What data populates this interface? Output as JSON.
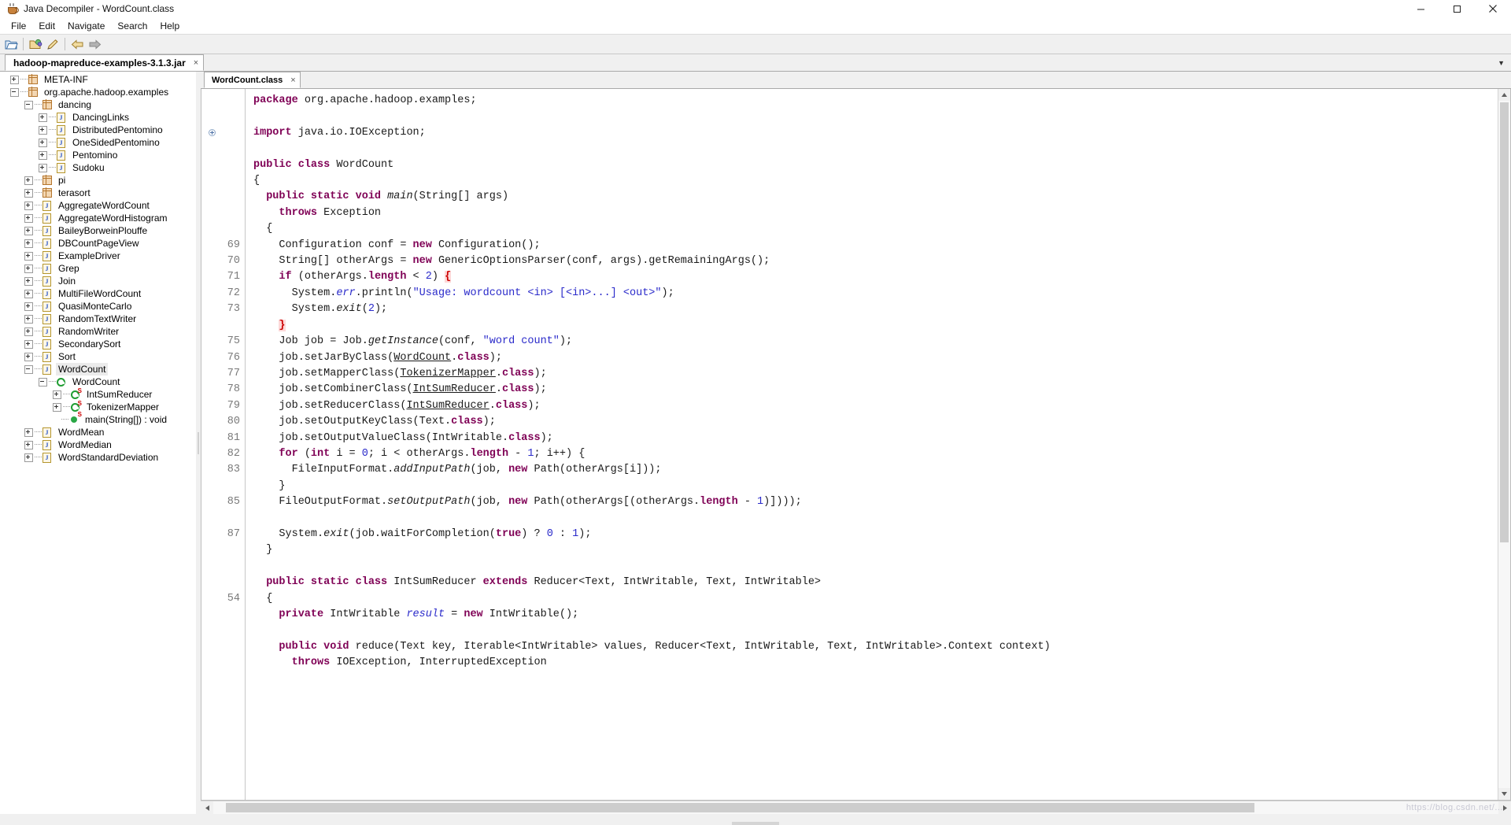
{
  "window": {
    "title": "Java Decompiler - WordCount.class",
    "icon": "java-cup-icon",
    "minimize_label": "─",
    "maximize_label": "❐",
    "close_label": "✕"
  },
  "menubar": {
    "items": [
      {
        "label": "File",
        "mnemonic": "F"
      },
      {
        "label": "Edit",
        "mnemonic": "E"
      },
      {
        "label": "Navigate",
        "mnemonic": "N"
      },
      {
        "label": "Search",
        "mnemonic": "a"
      },
      {
        "label": "Help",
        "mnemonic": "H"
      }
    ]
  },
  "toolbar": {
    "buttons": [
      {
        "name": "open-file-icon",
        "title": "Open File"
      },
      {
        "name": "open-type-icon",
        "title": "Open Type"
      },
      {
        "name": "save-source-icon",
        "title": "Save Source"
      },
      {
        "name": "back-arrow-icon",
        "title": "Back"
      },
      {
        "name": "forward-arrow-icon",
        "title": "Forward"
      }
    ]
  },
  "jar_tabs": {
    "tabs": [
      {
        "label": "hadoop-mapreduce-examples-3.1.3.jar",
        "close": "×",
        "active": true
      }
    ],
    "overflow": "▼"
  },
  "tree": {
    "nodes": [
      {
        "depth": 0,
        "toggle": "plus",
        "icon": "package-icon",
        "label": "META-INF",
        "selected": false
      },
      {
        "depth": 0,
        "toggle": "minus",
        "icon": "package-icon",
        "label": "org.apache.hadoop.examples",
        "selected": false
      },
      {
        "depth": 1,
        "toggle": "minus",
        "icon": "package-icon",
        "label": "dancing",
        "selected": false
      },
      {
        "depth": 2,
        "toggle": "plus",
        "icon": "class-file-icon",
        "label": "DancingLinks",
        "selected": false
      },
      {
        "depth": 2,
        "toggle": "plus",
        "icon": "class-file-icon",
        "label": "DistributedPentomino",
        "selected": false
      },
      {
        "depth": 2,
        "toggle": "plus",
        "icon": "class-file-icon",
        "label": "OneSidedPentomino",
        "selected": false
      },
      {
        "depth": 2,
        "toggle": "plus",
        "icon": "class-file-icon",
        "label": "Pentomino",
        "selected": false
      },
      {
        "depth": 2,
        "toggle": "plus",
        "icon": "class-file-icon",
        "label": "Sudoku",
        "selected": false
      },
      {
        "depth": 1,
        "toggle": "plus",
        "icon": "package-icon",
        "label": "pi",
        "selected": false
      },
      {
        "depth": 1,
        "toggle": "plus",
        "icon": "package-icon",
        "label": "terasort",
        "selected": false
      },
      {
        "depth": 1,
        "toggle": "plus",
        "icon": "class-file-icon",
        "label": "AggregateWordCount",
        "selected": false
      },
      {
        "depth": 1,
        "toggle": "plus",
        "icon": "class-file-icon",
        "label": "AggregateWordHistogram",
        "selected": false
      },
      {
        "depth": 1,
        "toggle": "plus",
        "icon": "class-file-icon",
        "label": "BaileyBorweinPlouffe",
        "selected": false
      },
      {
        "depth": 1,
        "toggle": "plus",
        "icon": "class-file-icon",
        "label": "DBCountPageView",
        "selected": false
      },
      {
        "depth": 1,
        "toggle": "plus",
        "icon": "class-file-icon",
        "label": "ExampleDriver",
        "selected": false
      },
      {
        "depth": 1,
        "toggle": "plus",
        "icon": "class-file-icon",
        "label": "Grep",
        "selected": false
      },
      {
        "depth": 1,
        "toggle": "plus",
        "icon": "class-file-icon",
        "label": "Join",
        "selected": false
      },
      {
        "depth": 1,
        "toggle": "plus",
        "icon": "class-file-icon",
        "label": "MultiFileWordCount",
        "selected": false
      },
      {
        "depth": 1,
        "toggle": "plus",
        "icon": "class-file-icon",
        "label": "QuasiMonteCarlo",
        "selected": false
      },
      {
        "depth": 1,
        "toggle": "plus",
        "icon": "class-file-icon",
        "label": "RandomTextWriter",
        "selected": false
      },
      {
        "depth": 1,
        "toggle": "plus",
        "icon": "class-file-icon",
        "label": "RandomWriter",
        "selected": false
      },
      {
        "depth": 1,
        "toggle": "plus",
        "icon": "class-file-icon",
        "label": "SecondarySort",
        "selected": false
      },
      {
        "depth": 1,
        "toggle": "plus",
        "icon": "class-file-icon",
        "label": "Sort",
        "selected": false
      },
      {
        "depth": 1,
        "toggle": "minus",
        "icon": "class-file-icon",
        "label": "WordCount",
        "selected": true
      },
      {
        "depth": 2,
        "toggle": "minus",
        "icon": "class-icon",
        "label": "WordCount",
        "selected": false
      },
      {
        "depth": 3,
        "toggle": "plus",
        "icon": "class-static-icon",
        "label": "IntSumReducer",
        "selected": false
      },
      {
        "depth": 3,
        "toggle": "plus",
        "icon": "class-static-icon",
        "label": "TokenizerMapper",
        "selected": false
      },
      {
        "depth": 3,
        "toggle": "none",
        "icon": "method-static-icon",
        "label": "main(String[]) : void",
        "selected": false
      },
      {
        "depth": 1,
        "toggle": "plus",
        "icon": "class-file-icon",
        "label": "WordMean",
        "selected": false
      },
      {
        "depth": 1,
        "toggle": "plus",
        "icon": "class-file-icon",
        "label": "WordMedian",
        "selected": false
      },
      {
        "depth": 1,
        "toggle": "plus",
        "icon": "class-file-icon",
        "label": "WordStandardDeviation",
        "selected": false
      }
    ]
  },
  "file_tabs": {
    "tabs": [
      {
        "label": "WordCount.class",
        "close": "×",
        "active": true
      }
    ]
  },
  "editor": {
    "line_numbers": [
      "",
      "",
      "",
      "",
      "",
      "",
      "",
      "",
      "",
      "69",
      "70",
      "71",
      "72",
      "73",
      "",
      "75",
      "76",
      "77",
      "78",
      "79",
      "80",
      "81",
      "82",
      "83",
      "",
      "85",
      "",
      "87",
      "",
      "",
      "",
      "54",
      "",
      ""
    ],
    "fold_marker_line": 2,
    "lines": [
      [
        {
          "t": "package ",
          "c": "kw"
        },
        {
          "t": "org.apache.hadoop.examples;",
          "c": ""
        }
      ],
      [
        {
          "t": "",
          "c": ""
        }
      ],
      [
        {
          "t": "import ",
          "c": "kw"
        },
        {
          "t": "java.io.IOException;",
          "c": ""
        }
      ],
      [
        {
          "t": "",
          "c": ""
        }
      ],
      [
        {
          "t": "public class ",
          "c": "kw"
        },
        {
          "t": "WordCount",
          "c": ""
        }
      ],
      [
        {
          "t": "{",
          "c": ""
        }
      ],
      [
        {
          "t": "  ",
          "c": ""
        },
        {
          "t": "public static void ",
          "c": "kw"
        },
        {
          "t": "main",
          "c": "mth"
        },
        {
          "t": "(String[] args)",
          "c": ""
        }
      ],
      [
        {
          "t": "    ",
          "c": ""
        },
        {
          "t": "throws ",
          "c": "kw"
        },
        {
          "t": "Exception",
          "c": ""
        }
      ],
      [
        {
          "t": "  {",
          "c": ""
        }
      ],
      [
        {
          "t": "    Configuration conf = ",
          "c": ""
        },
        {
          "t": "new ",
          "c": "kw"
        },
        {
          "t": "Configuration();",
          "c": ""
        }
      ],
      [
        {
          "t": "    String[] otherArgs = ",
          "c": ""
        },
        {
          "t": "new ",
          "c": "kw"
        },
        {
          "t": "GenericOptionsParser(conf, args).getRemainingArgs();",
          "c": ""
        }
      ],
      [
        {
          "t": "    ",
          "c": ""
        },
        {
          "t": "if ",
          "c": "kw"
        },
        {
          "t": "(otherArgs.",
          "c": ""
        },
        {
          "t": "length",
          "c": "kw"
        },
        {
          "t": " < ",
          "c": ""
        },
        {
          "t": "2",
          "c": "num"
        },
        {
          "t": ") ",
          "c": ""
        },
        {
          "t": "{",
          "c": "brc"
        }
      ],
      [
        {
          "t": "      System.",
          "c": ""
        },
        {
          "t": "err",
          "c": "fld"
        },
        {
          "t": ".println(",
          "c": ""
        },
        {
          "t": "\"Usage: wordcount <in> [<in>...] <out>\"",
          "c": "str"
        },
        {
          "t": ");",
          "c": ""
        }
      ],
      [
        {
          "t": "      System.",
          "c": ""
        },
        {
          "t": "exit",
          "c": "mth"
        },
        {
          "t": "(",
          "c": ""
        },
        {
          "t": "2",
          "c": "num"
        },
        {
          "t": ");",
          "c": ""
        }
      ],
      [
        {
          "t": "    ",
          "c": ""
        },
        {
          "t": "}",
          "c": "brc"
        }
      ],
      [
        {
          "t": "    Job job = Job.",
          "c": ""
        },
        {
          "t": "getInstance",
          "c": "mth"
        },
        {
          "t": "(conf, ",
          "c": ""
        },
        {
          "t": "\"word count\"",
          "c": "str"
        },
        {
          "t": ");",
          "c": ""
        }
      ],
      [
        {
          "t": "    job.setJarByClass(",
          "c": ""
        },
        {
          "t": "WordCount",
          "c": "ul"
        },
        {
          "t": ".",
          "c": ""
        },
        {
          "t": "class",
          "c": "kw"
        },
        {
          "t": ");",
          "c": ""
        }
      ],
      [
        {
          "t": "    job.setMapperClass(",
          "c": ""
        },
        {
          "t": "TokenizerMapper",
          "c": "ul"
        },
        {
          "t": ".",
          "c": ""
        },
        {
          "t": "class",
          "c": "kw"
        },
        {
          "t": ");",
          "c": ""
        }
      ],
      [
        {
          "t": "    job.setCombinerClass(",
          "c": ""
        },
        {
          "t": "IntSumReducer",
          "c": "ul"
        },
        {
          "t": ".",
          "c": ""
        },
        {
          "t": "class",
          "c": "kw"
        },
        {
          "t": ");",
          "c": ""
        }
      ],
      [
        {
          "t": "    job.setReducerClass(",
          "c": ""
        },
        {
          "t": "IntSumReducer",
          "c": "ul"
        },
        {
          "t": ".",
          "c": ""
        },
        {
          "t": "class",
          "c": "kw"
        },
        {
          "t": ");",
          "c": ""
        }
      ],
      [
        {
          "t": "    job.setOutputKeyClass(Text.",
          "c": ""
        },
        {
          "t": "class",
          "c": "kw"
        },
        {
          "t": ");",
          "c": ""
        }
      ],
      [
        {
          "t": "    job.setOutputValueClass(IntWritable.",
          "c": ""
        },
        {
          "t": "class",
          "c": "kw"
        },
        {
          "t": ");",
          "c": ""
        }
      ],
      [
        {
          "t": "    ",
          "c": ""
        },
        {
          "t": "for ",
          "c": "kw"
        },
        {
          "t": "(",
          "c": ""
        },
        {
          "t": "int ",
          "c": "kw"
        },
        {
          "t": "i = ",
          "c": ""
        },
        {
          "t": "0",
          "c": "num"
        },
        {
          "t": "; i < otherArgs.",
          "c": ""
        },
        {
          "t": "length",
          "c": "kw"
        },
        {
          "t": " - ",
          "c": ""
        },
        {
          "t": "1",
          "c": "num"
        },
        {
          "t": "; i++) {",
          "c": ""
        }
      ],
      [
        {
          "t": "      FileInputFormat.",
          "c": ""
        },
        {
          "t": "addInputPath",
          "c": "mth"
        },
        {
          "t": "(job, ",
          "c": ""
        },
        {
          "t": "new ",
          "c": "kw"
        },
        {
          "t": "Path(otherArgs[i]));",
          "c": ""
        }
      ],
      [
        {
          "t": "    }",
          "c": ""
        }
      ],
      [
        {
          "t": "    FileOutputFormat.",
          "c": ""
        },
        {
          "t": "setOutputPath",
          "c": "mth"
        },
        {
          "t": "(job, ",
          "c": ""
        },
        {
          "t": "new ",
          "c": "kw"
        },
        {
          "t": "Path(otherArgs[(otherArgs.",
          "c": ""
        },
        {
          "t": "length",
          "c": "kw"
        },
        {
          "t": " - ",
          "c": ""
        },
        {
          "t": "1",
          "c": "num"
        },
        {
          "t": ")])));",
          "c": ""
        }
      ],
      [
        {
          "t": "",
          "c": ""
        }
      ],
      [
        {
          "t": "    System.",
          "c": ""
        },
        {
          "t": "exit",
          "c": "mth"
        },
        {
          "t": "(job.waitForCompletion(",
          "c": ""
        },
        {
          "t": "true",
          "c": "kw"
        },
        {
          "t": ") ? ",
          "c": ""
        },
        {
          "t": "0",
          "c": "num"
        },
        {
          "t": " : ",
          "c": ""
        },
        {
          "t": "1",
          "c": "num"
        },
        {
          "t": ");",
          "c": ""
        }
      ],
      [
        {
          "t": "  }",
          "c": ""
        }
      ],
      [
        {
          "t": "",
          "c": ""
        }
      ],
      [
        {
          "t": "  ",
          "c": ""
        },
        {
          "t": "public static class ",
          "c": "kw"
        },
        {
          "t": "IntSumReducer ",
          "c": ""
        },
        {
          "t": "extends ",
          "c": "kw"
        },
        {
          "t": "Reducer<Text, IntWritable, Text, IntWritable>",
          "c": ""
        }
      ],
      [
        {
          "t": "  {",
          "c": ""
        }
      ],
      [
        {
          "t": "    ",
          "c": ""
        },
        {
          "t": "private ",
          "c": "kw"
        },
        {
          "t": "IntWritable ",
          "c": ""
        },
        {
          "t": "result",
          "c": "fld"
        },
        {
          "t": " = ",
          "c": ""
        },
        {
          "t": "new ",
          "c": "kw"
        },
        {
          "t": "IntWritable();",
          "c": ""
        }
      ],
      [
        {
          "t": "",
          "c": ""
        }
      ],
      [
        {
          "t": "    ",
          "c": ""
        },
        {
          "t": "public void ",
          "c": "kw"
        },
        {
          "t": "reduce(Text key, Iterable<IntWritable> values, Reducer<Text, IntWritable, Text, IntWritable>.Context context)",
          "c": ""
        }
      ],
      [
        {
          "t": "      ",
          "c": ""
        },
        {
          "t": "throws ",
          "c": "kw"
        },
        {
          "t": "IOException, InterruptedException",
          "c": ""
        }
      ]
    ]
  },
  "scrollbars": {
    "vertical_up": "▲",
    "vertical_down": "▼",
    "horizontal_left": "◀",
    "horizontal_right": "▶"
  },
  "watermark": "https://blog.csdn.net/..."
}
